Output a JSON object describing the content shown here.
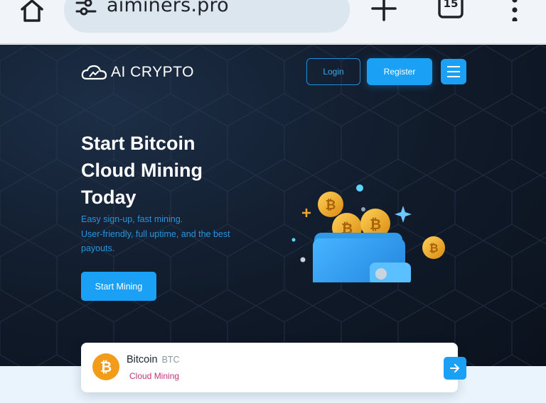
{
  "browser": {
    "url": "aiminers.pro",
    "tab_count": "15",
    "icons": [
      "home-icon",
      "site-settings-icon",
      "new-tab-icon",
      "tabs-icon",
      "more-vert-icon"
    ]
  },
  "header": {
    "logo_text": "AI CRYPTO",
    "login_label": "Login",
    "register_label": "Register",
    "menu_icon": "hamburger-icon"
  },
  "hero": {
    "title_lines": [
      "Start Bitcoin",
      "Cloud Mining",
      "Today"
    ],
    "subtitle_lines": [
      "Easy sign-up, fast mining.",
      "User-friendly, full uptime, and the best",
      "payouts."
    ],
    "cta_label": "Start Mining"
  },
  "coin_card": {
    "name": "Bitcoin",
    "ticker": "BTC",
    "type": "Cloud Mining",
    "arrow_icon": "arrow-right-icon"
  },
  "colors": {
    "accent": "#1aa0f5",
    "hero_bg": "#101a29",
    "subtitle": "#2a93dc",
    "btc_orange": "#f39c1a",
    "card_type": "#c0357a"
  }
}
